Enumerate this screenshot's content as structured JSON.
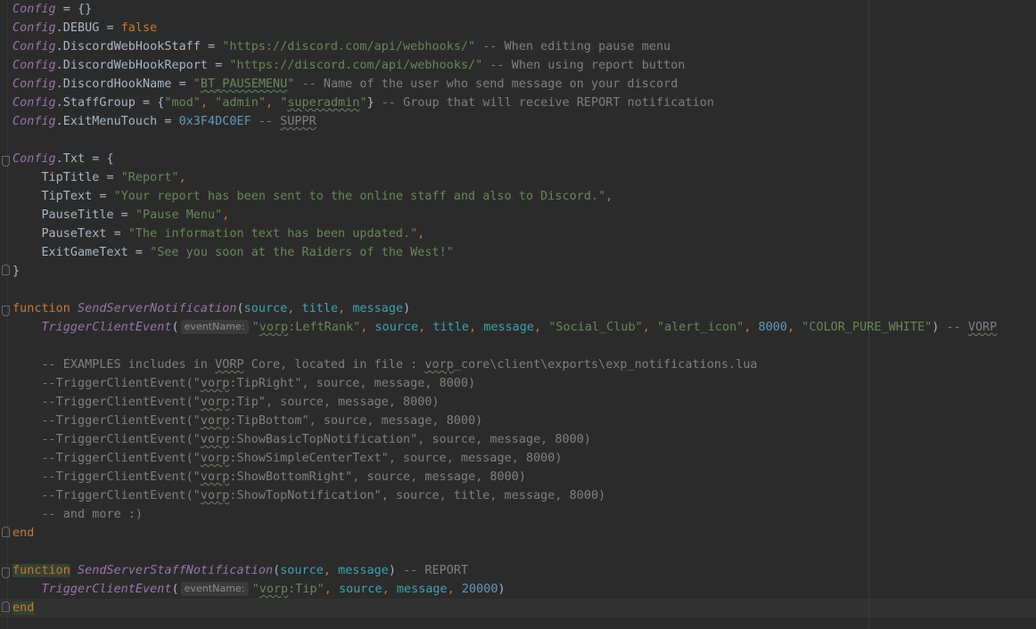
{
  "editor": {
    "colors": {
      "background": "#2b2b2b",
      "global": "#9876aa",
      "keyword": "#cc7832",
      "string": "#6a8759",
      "number": "#6897bb",
      "comment": "#808080",
      "parameter": "#3fa4b0",
      "plain": "#a9b7c6"
    },
    "lines": [
      [
        {
          "k": "glob",
          "t": "Config"
        },
        {
          "k": "plain",
          "t": " = {}"
        }
      ],
      [
        {
          "k": "glob",
          "t": "Config"
        },
        {
          "k": "plain",
          "t": ".DEBUG = "
        },
        {
          "k": "kw",
          "t": "false"
        }
      ],
      [
        {
          "k": "glob",
          "t": "Config"
        },
        {
          "k": "plain",
          "t": ".DiscordWebHookStaff = "
        },
        {
          "k": "str",
          "t": "\"https://discord.com/api/webhooks/\""
        },
        {
          "k": "cmt",
          "t": " -- When editing pause menu"
        }
      ],
      [
        {
          "k": "glob",
          "t": "Config"
        },
        {
          "k": "plain",
          "t": ".DiscordWebHookReport = "
        },
        {
          "k": "str",
          "t": "\"https://discord.com/api/webhooks/\""
        },
        {
          "k": "cmt",
          "t": " -- When using report button"
        }
      ],
      [
        {
          "k": "glob",
          "t": "Config"
        },
        {
          "k": "plain",
          "t": ".DiscordHookName = "
        },
        {
          "k": "str",
          "t": "\""
        },
        {
          "k": "str typo",
          "t": "BT_PAUSEMENU"
        },
        {
          "k": "str",
          "t": "\""
        },
        {
          "k": "cmt",
          "t": " -- Name of the user who send message on your discord"
        }
      ],
      [
        {
          "k": "glob",
          "t": "Config"
        },
        {
          "k": "plain",
          "t": ".StaffGroup = {"
        },
        {
          "k": "str",
          "t": "\"mod\""
        },
        {
          "k": "kw",
          "t": ", "
        },
        {
          "k": "str",
          "t": "\"admin\""
        },
        {
          "k": "kw",
          "t": ", "
        },
        {
          "k": "str",
          "t": "\""
        },
        {
          "k": "str typo",
          "t": "superadmin"
        },
        {
          "k": "str",
          "t": "\""
        },
        {
          "k": "plain",
          "t": "}"
        },
        {
          "k": "cmt",
          "t": " -- Group that will receive REPORT notification"
        }
      ],
      [
        {
          "k": "glob",
          "t": "Config"
        },
        {
          "k": "plain",
          "t": ".ExitMenuTouch = "
        },
        {
          "k": "num",
          "t": "0x3F4DC0EF"
        },
        {
          "k": "cmt",
          "t": " -- "
        },
        {
          "k": "cmt typo-c",
          "t": "SUPPR"
        }
      ],
      [],
      [
        {
          "k": "glob",
          "t": "Config"
        },
        {
          "k": "plain",
          "t": ".Txt = {"
        }
      ],
      [
        {
          "k": "plain",
          "t": "    TipTitle = "
        },
        {
          "k": "str",
          "t": "\"Report\""
        },
        {
          "k": "kw",
          "t": ","
        }
      ],
      [
        {
          "k": "plain",
          "t": "    TipText = "
        },
        {
          "k": "str",
          "t": "\"Your report has been sent to the online staff and also to Discord.\""
        },
        {
          "k": "kw",
          "t": ","
        }
      ],
      [
        {
          "k": "plain",
          "t": "    PauseTitle = "
        },
        {
          "k": "str",
          "t": "\"Pause Menu\""
        },
        {
          "k": "kw",
          "t": ","
        }
      ],
      [
        {
          "k": "plain",
          "t": "    PauseText = "
        },
        {
          "k": "str",
          "t": "\"The information text has been updated.\""
        },
        {
          "k": "kw",
          "t": ","
        }
      ],
      [
        {
          "k": "plain",
          "t": "    ExitGameText = "
        },
        {
          "k": "str",
          "t": "\"See you soon at the Raiders of the West!\""
        }
      ],
      [
        {
          "k": "plain",
          "t": "}"
        }
      ],
      [],
      [
        {
          "k": "kw",
          "t": "function "
        },
        {
          "k": "fnc",
          "t": "SendServerNotification"
        },
        {
          "k": "plain",
          "t": "("
        },
        {
          "k": "param",
          "t": "source"
        },
        {
          "k": "kw",
          "t": ", "
        },
        {
          "k": "param",
          "t": "title"
        },
        {
          "k": "kw",
          "t": ", "
        },
        {
          "k": "param",
          "t": "message"
        },
        {
          "k": "plain",
          "t": ")"
        }
      ],
      [
        {
          "k": "plain",
          "t": "    "
        },
        {
          "k": "fnc",
          "t": "TriggerClientEvent"
        },
        {
          "k": "plain",
          "t": "("
        },
        {
          "k": "hint",
          "t": "eventName:"
        },
        {
          "k": "str",
          "t": "\""
        },
        {
          "k": "str typo",
          "t": "vorp"
        },
        {
          "k": "str",
          "t": ":LeftRank\""
        },
        {
          "k": "kw",
          "t": ", "
        },
        {
          "k": "param",
          "t": "source"
        },
        {
          "k": "kw",
          "t": ", "
        },
        {
          "k": "param",
          "t": "title"
        },
        {
          "k": "kw",
          "t": ", "
        },
        {
          "k": "param",
          "t": "message"
        },
        {
          "k": "kw",
          "t": ", "
        },
        {
          "k": "str",
          "t": "\"Social_Club\""
        },
        {
          "k": "kw",
          "t": ", "
        },
        {
          "k": "str",
          "t": "\"alert_icon\""
        },
        {
          "k": "kw",
          "t": ", "
        },
        {
          "k": "num",
          "t": "8000"
        },
        {
          "k": "kw",
          "t": ", "
        },
        {
          "k": "str",
          "t": "\"COLOR_PURE_WHITE\""
        },
        {
          "k": "plain",
          "t": ")"
        },
        {
          "k": "cmt",
          "t": " -- "
        },
        {
          "k": "cmt typo-c",
          "t": "VORP"
        }
      ],
      [],
      [
        {
          "k": "cmt",
          "t": "    -- EXAMPLES includes in "
        },
        {
          "k": "cmt typo-c",
          "t": "VORP"
        },
        {
          "k": "cmt",
          "t": " Core, located in file : "
        },
        {
          "k": "cmt typo-c",
          "t": "vorp"
        },
        {
          "k": "cmt",
          "t": "_core\\client\\exports\\exp_notifications.lua"
        }
      ],
      [
        {
          "k": "cmt",
          "t": "    --TriggerClientEvent(\""
        },
        {
          "k": "cmt typo-c",
          "t": "vorp"
        },
        {
          "k": "cmt",
          "t": ":TipRight\", source, message, 8000)"
        }
      ],
      [
        {
          "k": "cmt",
          "t": "    --TriggerClientEvent(\""
        },
        {
          "k": "cmt typo-c",
          "t": "vorp"
        },
        {
          "k": "cmt",
          "t": ":Tip\", source, message, 8000)"
        }
      ],
      [
        {
          "k": "cmt",
          "t": "    --TriggerClientEvent(\""
        },
        {
          "k": "cmt typo-c",
          "t": "vorp"
        },
        {
          "k": "cmt",
          "t": ":TipBottom\", source, message, 8000)"
        }
      ],
      [
        {
          "k": "cmt",
          "t": "    --TriggerClientEvent(\""
        },
        {
          "k": "cmt typo-c",
          "t": "vorp"
        },
        {
          "k": "cmt",
          "t": ":ShowBasicTopNotification\", source, message, 8000)"
        }
      ],
      [
        {
          "k": "cmt",
          "t": "    --TriggerClientEvent(\""
        },
        {
          "k": "cmt typo-c",
          "t": "vorp"
        },
        {
          "k": "cmt",
          "t": ":ShowSimpleCenterText\", source, message, 8000)"
        }
      ],
      [
        {
          "k": "cmt",
          "t": "    --TriggerClientEvent(\""
        },
        {
          "k": "cmt typo-c",
          "t": "vorp"
        },
        {
          "k": "cmt",
          "t": ":ShowBottomRight\", source, message, 8000)"
        }
      ],
      [
        {
          "k": "cmt",
          "t": "    --TriggerClientEvent(\""
        },
        {
          "k": "cmt typo-c",
          "t": "vorp"
        },
        {
          "k": "cmt",
          "t": ":ShowTopNotification\", source, title, message, 8000)"
        }
      ],
      [
        {
          "k": "cmt",
          "t": "    -- and more :)"
        }
      ],
      [
        {
          "k": "kw",
          "t": "end"
        }
      ],
      [],
      [
        {
          "k": "hl-fn",
          "t": "function"
        },
        {
          "k": "kw",
          "t": " "
        },
        {
          "k": "fnc",
          "t": "SendServerStaffNotification"
        },
        {
          "k": "plain",
          "t": "("
        },
        {
          "k": "param",
          "t": "source"
        },
        {
          "k": "kw",
          "t": ", "
        },
        {
          "k": "param",
          "t": "message"
        },
        {
          "k": "plain",
          "t": ")"
        },
        {
          "k": "cmt",
          "t": " -- REPORT"
        }
      ],
      [
        {
          "k": "plain",
          "t": "    "
        },
        {
          "k": "fnc",
          "t": "TriggerClientEvent"
        },
        {
          "k": "plain",
          "t": "("
        },
        {
          "k": "hint",
          "t": "eventName:"
        },
        {
          "k": "str",
          "t": "\""
        },
        {
          "k": "str typo",
          "t": "vorp"
        },
        {
          "k": "str",
          "t": ":Tip\""
        },
        {
          "k": "kw",
          "t": ", "
        },
        {
          "k": "param",
          "t": "source"
        },
        {
          "k": "kw",
          "t": ", "
        },
        {
          "k": "param",
          "t": "message"
        },
        {
          "k": "kw",
          "t": ", "
        },
        {
          "k": "num",
          "t": "20000"
        },
        {
          "k": "plain",
          "t": ")"
        }
      ],
      [
        {
          "k": "hl-end",
          "t": "end"
        }
      ]
    ]
  }
}
